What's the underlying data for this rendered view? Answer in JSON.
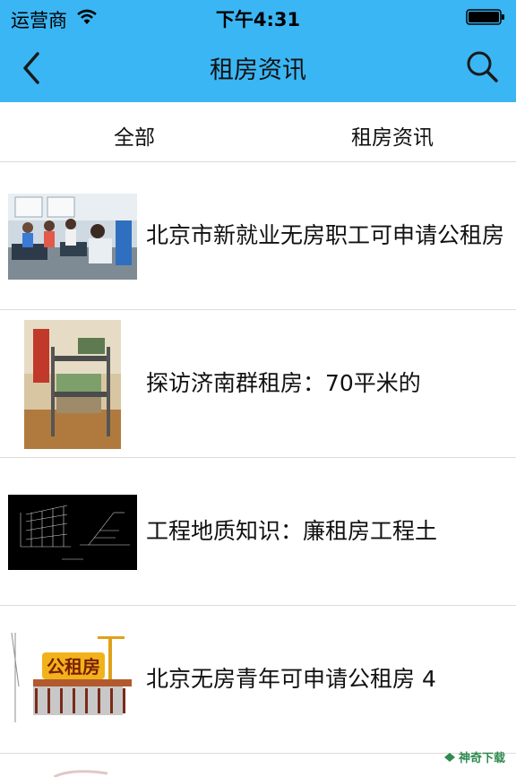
{
  "status": {
    "carrier": "运营商",
    "time": "下午4:31"
  },
  "nav": {
    "title": "租房资讯",
    "back_icon": "chevron-left-icon",
    "search_icon": "search-icon"
  },
  "tabs": [
    {
      "label": "全部"
    },
    {
      "label": "租房资讯"
    }
  ],
  "list": {
    "items": [
      {
        "title": "北京市新就业无房职工可申请公租房",
        "thumb": "office-photo"
      },
      {
        "title": "探访济南群租房：70平米的",
        "thumb": "bunk-bed-photo"
      },
      {
        "title": "工程地质知识：廉租房工程土",
        "thumb": "blueprint-drawing"
      },
      {
        "title": "北京无房青年可申请公租房 4",
        "thumb": "building-construction"
      }
    ]
  },
  "watermark": {
    "text": "神奇下载"
  },
  "colors": {
    "header_bg": "#3bb6f4",
    "divider": "#dcdcdc"
  }
}
